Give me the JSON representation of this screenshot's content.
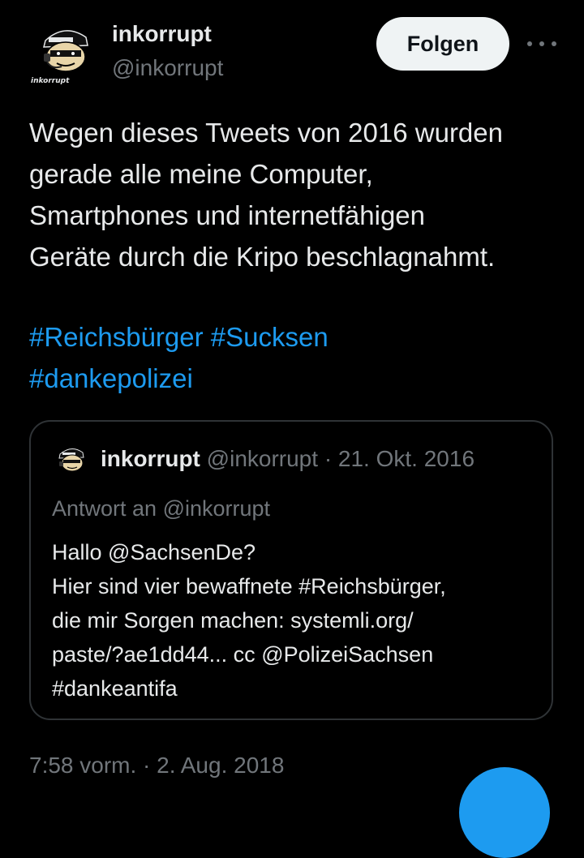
{
  "author": {
    "display_name": "inkorrupt",
    "handle": "@inkorrupt",
    "avatar_caption": "inkorrupt"
  },
  "actions": {
    "follow_label": "Folgen",
    "more_icon": "more-horizontal-icon"
  },
  "tweet": {
    "text_lines": [
      "Wegen dieses Tweets von 2016 wurden",
      "gerade alle meine Computer,",
      "Smartphones und internetfähigen",
      "Geräte durch die Kripo beschlagnahmt."
    ],
    "hashtags": [
      "#Reichsbürger",
      "#Sucksen",
      "#dankepolizei"
    ],
    "timestamp": "7:58 vorm. · 2. Aug. 2018"
  },
  "quoted_tweet": {
    "display_name": "inkorrupt",
    "meta": "@inkorrupt · 21. Okt. 2016",
    "reply_to": "Antwort an @inkorrupt",
    "text_lines": [
      "Hallo @SachsenDe?",
      "Hier sind vier bewaffnete #Reichsbürger,",
      "die mir Sorgen machen: systemli.org/",
      "paste/?ae1dd44... cc @PolizeiSachsen",
      "#dankeantifa"
    ]
  },
  "colors": {
    "background": "#000000",
    "text": "#e7e9ea",
    "secondary": "#71767b",
    "link": "#1d9bf0",
    "border": "#2f3336"
  }
}
